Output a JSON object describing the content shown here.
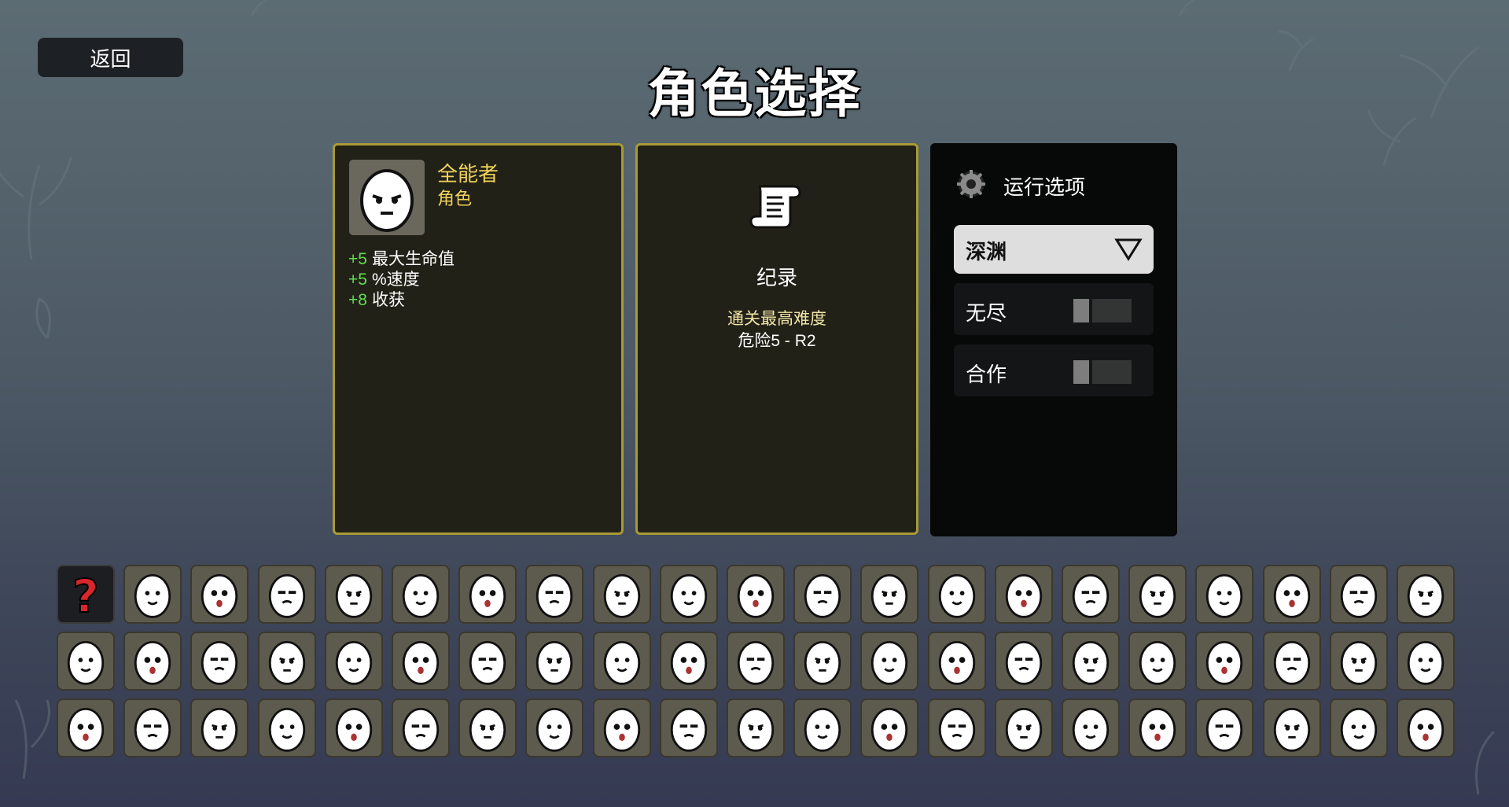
{
  "nav": {
    "back_label": "返回"
  },
  "screen_title": "角色选择",
  "character": {
    "name": "全能者",
    "type": "角色",
    "stats": [
      {
        "value": "+5",
        "label": "最大生命值"
      },
      {
        "value": "+5",
        "label": "%速度"
      },
      {
        "value": "+8",
        "label": "收获"
      }
    ]
  },
  "record": {
    "title": "纪录",
    "best_label": "通关最高难度",
    "best_value": "危险5 - R2"
  },
  "run_options": {
    "title": "运行选项",
    "mode_selected": "深渊",
    "endless_label": "无尽",
    "endless_on": false,
    "coop_label": "合作",
    "coop_on": false
  },
  "roster": {
    "rows": 3,
    "columns": 21,
    "selected_index": 1,
    "first_cell": "random-question-mark"
  },
  "colors": {
    "panel_border": "#a99a35",
    "name_text": "#f0d35a",
    "stat_positive": "#5ee04a",
    "cell_bg": "#5d5a4e"
  }
}
